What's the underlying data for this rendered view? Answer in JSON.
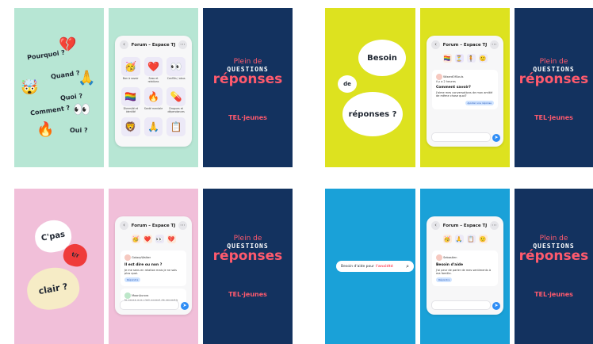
{
  "forum": {
    "title": "Forum – Espace TJ"
  },
  "brand": {
    "line1": "Plein de",
    "line2": "QUESTIONS",
    "line3": "réponses",
    "logo": "TEL·jeunes"
  },
  "row1": {
    "words": [
      "Pourquoi ?",
      "Quand ?",
      "Quoi ?",
      "Comment ?",
      "Oui ?"
    ],
    "tiles": [
      {
        "icon": "🥳",
        "label": "Bon à savoir"
      },
      {
        "icon": "❤️",
        "label": "Sexo et relations"
      },
      {
        "icon": "👀",
        "label": "Conflits / abus"
      },
      {
        "icon": "🏳️‍🌈",
        "label": "Diversité et identité"
      },
      {
        "icon": "🔥",
        "label": "Santé mentale"
      },
      {
        "icon": "💊",
        "label": "Drogues et dépendances"
      },
      {
        "icon": "🦁",
        "label": ""
      },
      {
        "icon": "🙏",
        "label": ""
      },
      {
        "icon": "📋",
        "label": ""
      }
    ],
    "bubbles": [
      "Besoin",
      "de",
      "réponses ?"
    ],
    "card": {
      "user": "WizardOfSouls",
      "meta": "il y a 2 heures",
      "question": "Comment savoir?",
      "body": "J'aime mes conversations de mon amitié de même chose quoi?",
      "reply": "Ajouter une réponse"
    }
  },
  "row2": {
    "hearts": [
      "C'pas",
      "t/r",
      "clair ?"
    ],
    "card1": {
      "user": "GalaxyWalker",
      "meta": "il y a",
      "question": "Il est dire ou non ?",
      "body": "Je me sens en relation mais je ne sais plus quoi.",
      "btn": "Répondre"
    },
    "card2": {
      "user": "MoonAurora",
      "meta": "il y a",
      "body": "Je pense que c'est normal de ressentir ça."
    },
    "search": {
      "text": "Besoin d'aide pour",
      "highlight": "l'anxiété"
    },
    "card3": {
      "user": "Sebastien",
      "meta": "il y a",
      "question": "Besoin d'aide",
      "body": "J'ai peur de parler de mes sentiments à ma famille.",
      "btn": "Répondre"
    }
  }
}
